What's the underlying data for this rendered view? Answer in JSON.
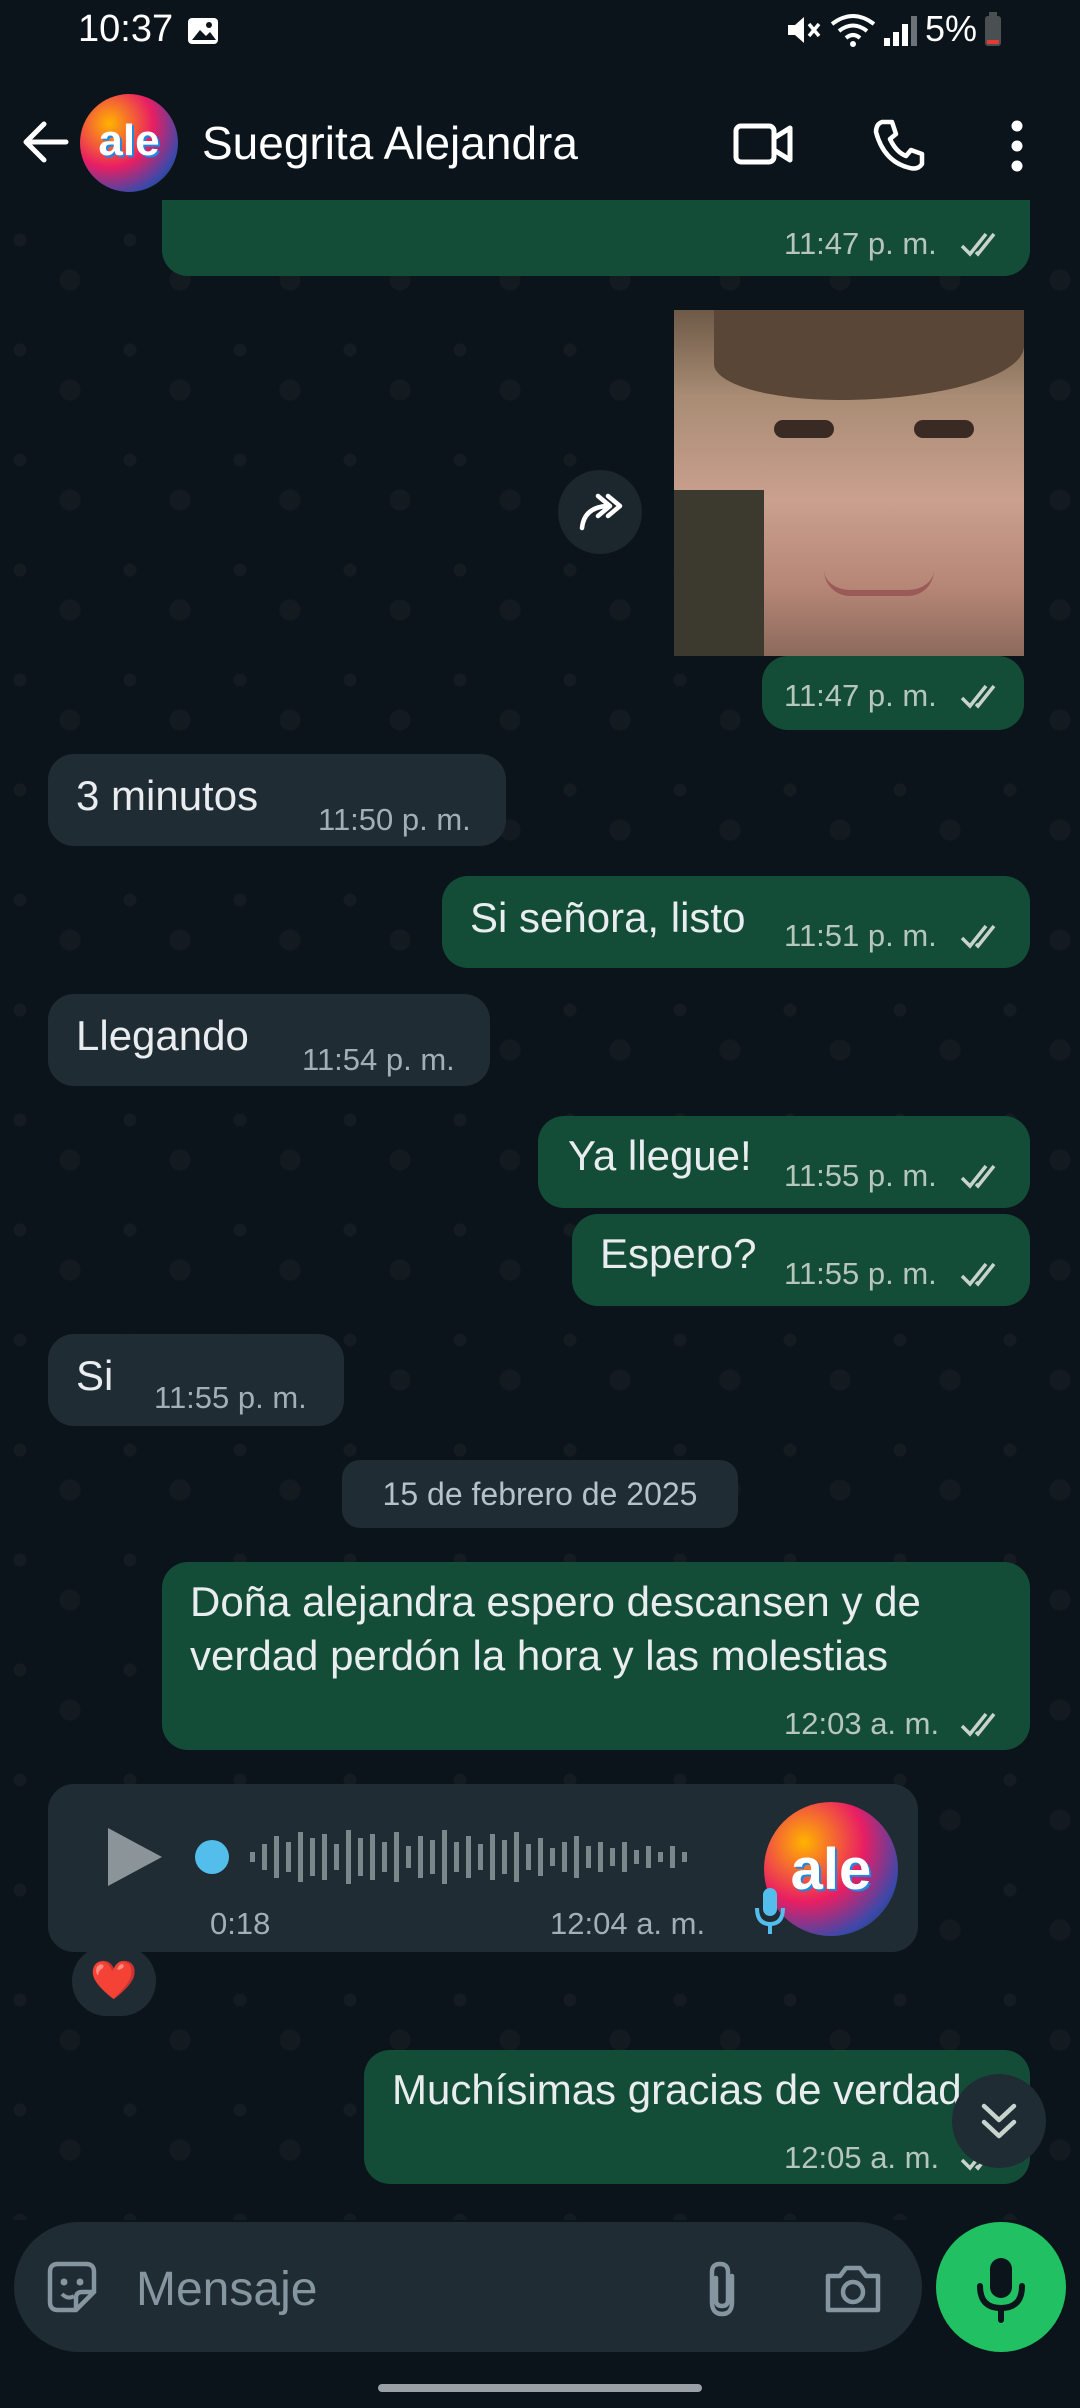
{
  "status_bar": {
    "time": "10:37",
    "battery": "5%"
  },
  "header": {
    "contact_name": "Suegrita Alejandra",
    "avatar_text": "ale"
  },
  "messages": [
    {
      "time": "11:47 p. m."
    },
    {
      "time": "11:47 p. m."
    },
    {
      "text": "3 minutos",
      "time": "11:50 p. m."
    },
    {
      "text": "Si señora, listo",
      "time": "11:51 p. m."
    },
    {
      "text": "Llegando",
      "time": "11:54 p. m."
    },
    {
      "text": "Ya llegue!",
      "time": "11:55 p. m."
    },
    {
      "text": "Espero?",
      "time": "11:55 p. m."
    },
    {
      "text": "Si",
      "time": "11:55 p. m."
    },
    {
      "text_line1": "Doña alejandra espero descansen y de",
      "text_line2": "verdad perdón la hora y las molestias",
      "time": "12:03 a. m."
    },
    {
      "duration": "0:18",
      "time": "12:04 a. m.",
      "reaction": "❤️"
    },
    {
      "text": "Muchísimas gracias de verdad",
      "time": "12:05 a. m."
    }
  ],
  "date_divider": "15 de febrero de 2025",
  "composer": {
    "placeholder": "Mensaje"
  },
  "colors": {
    "outgoing": "#144d37",
    "incoming": "#202c33",
    "accent": "#21c063"
  }
}
